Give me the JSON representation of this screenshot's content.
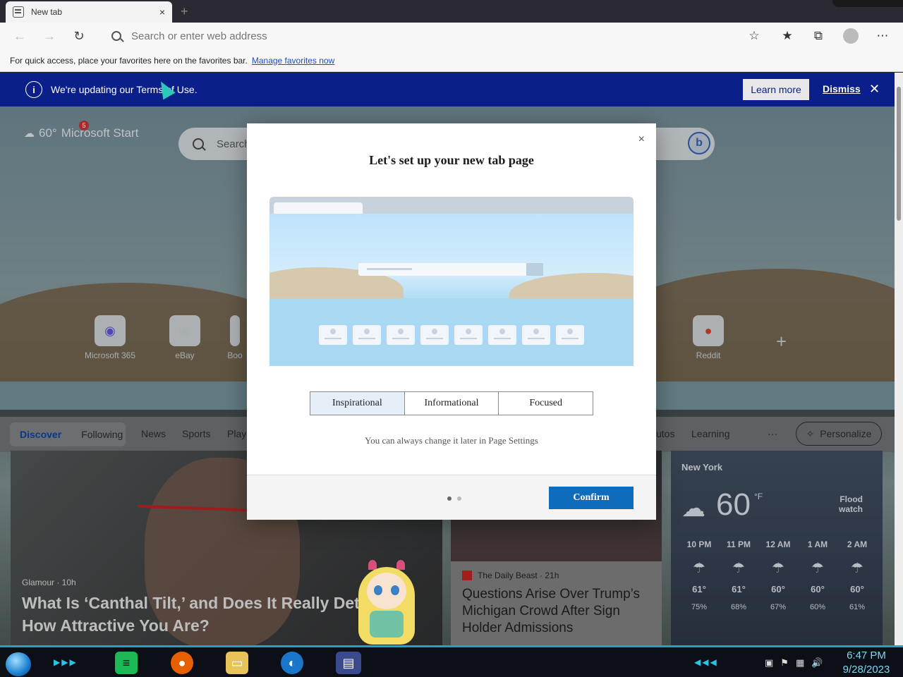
{
  "browser": {
    "tab_title": "New tab",
    "tab_close": "×",
    "address_placeholder": "Search or enter web address",
    "favorites_message": "For quick access, place your favorites here on the favorites bar.",
    "favorites_link": "Manage favorites now"
  },
  "banner": {
    "message": "We're updating our Terms of Use.",
    "learn_more": "Learn more",
    "dismiss": "Dismiss"
  },
  "newtab": {
    "brand": "Microsoft Start",
    "weather_temp_mini": "60°",
    "notification_count": "5",
    "search_placeholder": "Search",
    "quick_links": [
      {
        "label": "Microsoft 365"
      },
      {
        "label": "eBay"
      },
      {
        "label": "Boo"
      },
      {
        "label": "Reddit"
      }
    ],
    "feed_tabs": {
      "discover": "Discover",
      "following": "Following",
      "news": "News",
      "sports": "Sports",
      "play": "Play",
      "autos": "utos",
      "learning": "Learning",
      "more": "···",
      "personalize": "Personalize"
    },
    "card_main": {
      "source": "Glamour · 10h",
      "title": "What Is ‘Canthal Tilt,’ and Does It Really Determine How Attractive You Are?"
    },
    "card_two": {
      "source": "The Daily Beast · 21h",
      "title": "Questions Arise Over Trump’s Michigan Crowd After Sign Holder Admissions"
    },
    "weather": {
      "city": "New York",
      "temp": "60",
      "unit": "°F",
      "alert": "Flood watch",
      "hours": [
        {
          "time": "10 PM",
          "temp": "61°",
          "precip": "75%"
        },
        {
          "time": "11 PM",
          "temp": "61°",
          "precip": "68%"
        },
        {
          "time": "12 AM",
          "temp": "60°",
          "precip": "67%"
        },
        {
          "time": "1 AM",
          "temp": "60°",
          "precip": "60%"
        },
        {
          "time": "2 AM",
          "temp": "60°",
          "precip": "61%"
        }
      ]
    }
  },
  "modal": {
    "title": "Let's set up your new tab page",
    "options": [
      "Inspirational",
      "Informational",
      "Focused"
    ],
    "selected_option": "Inspirational",
    "hint": "You can always change it later in Page Settings",
    "confirm": "Confirm",
    "close": "×"
  },
  "taskbar": {
    "time": "6:47 PM",
    "date": "9/28/2023"
  },
  "colors": {
    "banner_bg": "#0a1f8a",
    "accent": "#0f6cbd",
    "taskbar_accent": "#18a5c8"
  }
}
